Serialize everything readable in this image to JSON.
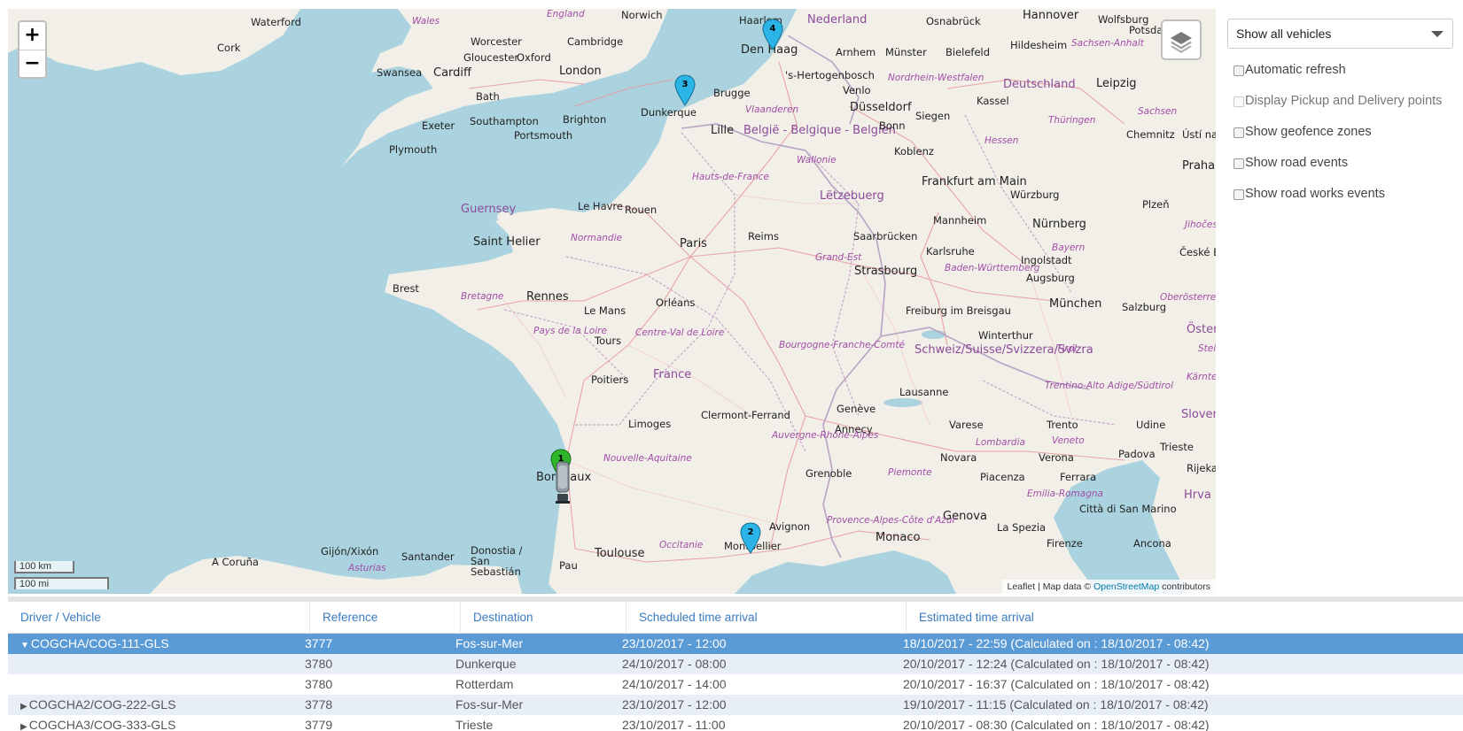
{
  "map": {
    "zoom_in": "+",
    "zoom_out": "−",
    "scale_km": "100 km",
    "scale_mi": "100 mi",
    "attribution_prefix": "Leaflet | Map data ©",
    "attribution_link": "OpenStreetMap",
    "attribution_suffix": "contributors",
    "markers": [
      {
        "number": "1",
        "color": "#2fb52b"
      },
      {
        "number": "2",
        "color": "#2ab4e8"
      },
      {
        "number": "3",
        "color": "#2ab4e8"
      },
      {
        "number": "4",
        "color": "#2ab4e8"
      }
    ],
    "labels": {
      "waterford": "Waterford",
      "cork": "Cork",
      "wales": "Wales",
      "england": "England",
      "norwich": "Norwich",
      "worcester": "Worcester",
      "cambridge": "Cambridge",
      "gloucester": "Gloucester",
      "oxford": "Oxford",
      "swansea": "Swansea",
      "cardiff": "Cardiff",
      "london": "London",
      "bath": "Bath",
      "exeter": "Exeter",
      "southampton": "Southampton",
      "brighton": "Brighton",
      "portsmouth": "Portsmouth",
      "plymouth": "Plymouth",
      "haarlem": "Haarlem",
      "nederland": "Nederland",
      "den_haag": "Den Haag",
      "arnhem": "Arnhem",
      "munster": "Münster",
      "osnabruck": "Osnabrück",
      "bielefeld": "Bielefeld",
      "hannover": "Hannover",
      "wolfsburg": "Wolfsburg",
      "potsdam": "Potsdam",
      "hildesheim": "Hildesheim",
      "sachsen_anhalt": "Sachsen-Anhalt",
      "hertogenbosch": "'s-Hertogenbosch",
      "venlo": "Venlo",
      "nordrhein": "Nordrhein-Westfalen",
      "deutschland": "Deutschland",
      "leipzig": "Leipzig",
      "brugge": "Brugge",
      "dunkerque": "Dunkerque",
      "vlaanderen": "Vlaanderen",
      "dusseldorf": "Düsseldorf",
      "kassel": "Kassel",
      "siegen": "Siegen",
      "sachsen": "Sachsen",
      "lille": "Lille",
      "belgie": "België - Belgique - Belgien",
      "bonn": "Bonn",
      "thuringen": "Thüringen",
      "chemnitz": "Chemnitz",
      "usti": "Ústí nad Labem",
      "wallonie": "Wallonie",
      "koblenz": "Koblenz",
      "hessen": "Hessen",
      "praha": "Praha",
      "hauts_de_france": "Hauts-de-France",
      "frankfurt": "Frankfurt am Main",
      "letzebuerg": "Lëtzebuerg",
      "wurzburg": "Würzburg",
      "guernsey": "Guernsey",
      "le_havre": "Le Havre",
      "rouen": "Rouen",
      "mannheim": "Mannheim",
      "nurnberg": "Nürnberg",
      "plzen": "Plzeň",
      "jihocesky": "Jihočeský",
      "saint_helier": "Saint Helier",
      "normandie": "Normandie",
      "paris": "Paris",
      "reims": "Reims",
      "saarbrucken": "Saarbrücken",
      "karlsruhe": "Karlsruhe",
      "bayern": "Bayern",
      "ingolstadt": "Ingolstadt",
      "ceske": "České Budějovice",
      "grand_est": "Grand-Est",
      "strasbourg": "Strasbourg",
      "baden": "Baden-Württemberg",
      "augsburg": "Augsburg",
      "brest": "Brest",
      "bretagne": "Bretagne",
      "rennes": "Rennes",
      "orleans": "Orléans",
      "oberosterreich": "Oberösterreich",
      "le_mans": "Le Mans",
      "freiburg": "Freiburg im Breisgau",
      "munchen": "München",
      "salzburg": "Salzburg",
      "pays_de_la_loire": "Pays de la Loire",
      "tours": "Tours",
      "centre": "Centre-Val de Loire",
      "bourgogne": "Bourgogne-Franche-Comté",
      "winterthur": "Winterthur",
      "oster": "Öster",
      "schweiz": "Schweiz/Suisse/Svizzera/Svizra",
      "tirol": "Tirol",
      "steier": "Steier",
      "poitiers": "Poitiers",
      "france": "France",
      "lausanne": "Lausanne",
      "karnten": "Kärnten",
      "trentino": "Trentino-Alto Adige/Südtirol",
      "geneve": "Genève",
      "limoges": "Limoges",
      "clermont": "Clermont-Ferrand",
      "annecy": "Annecy",
      "varese": "Varese",
      "trento": "Trento",
      "udine": "Udine",
      "sloven": "Sloven",
      "auvergne": "Auvergne-Rhône-Alpes",
      "lombardia": "Lombardia",
      "veneto": "Veneto",
      "trieste": "Trieste",
      "nouvelle_aquitaine": "Nouvelle-Aquitaine",
      "padova": "Padova",
      "rijeka": "Rijeka",
      "novara": "Novara",
      "verona": "Verona",
      "bordeaux": "Bordeaux",
      "grenoble": "Grenoble",
      "piemonte": "Piemonte",
      "piacenza": "Piacenza",
      "ferrara": "Ferrara",
      "hrva": "Hrva",
      "emilia": "Emilia-Romagna",
      "citta": "Città di San Marino",
      "genova": "Genova",
      "provence": "Provence-Alpes-Côte d'Azur",
      "avignon": "Avignon",
      "la_spezia": "La Spezia",
      "monaco": "Monaco",
      "firenze": "Firenze",
      "ancona": "Ancona",
      "a_coruna": "A Coruña",
      "gijon": "Gijón/Xixón",
      "santander": "Santander",
      "donostia": "Donostia / San Sebastián",
      "asturias": "Asturias",
      "pau": "Pau",
      "toulouse": "Toulouse",
      "occitanie": "Occitanie",
      "montpellier": "Montpellier"
    }
  },
  "panel": {
    "select_value": "Show all vehicles",
    "options": [
      {
        "label": "Automatic refresh",
        "disabled": false
      },
      {
        "label": "Display Pickup and Delivery points",
        "disabled": true
      },
      {
        "label": "Show geofence zones",
        "disabled": false
      },
      {
        "label": "Show road events",
        "disabled": false
      },
      {
        "label": "Show road works events",
        "disabled": false
      }
    ]
  },
  "table": {
    "headers": [
      "Driver / Vehicle",
      "Reference",
      "Destination",
      "Scheduled time arrival",
      "Estimated time arrival"
    ],
    "rows": [
      {
        "toggle": "▼",
        "driver": "COGCHA/COG-111-GLS",
        "reference": "3777",
        "destination": "Fos-sur-Mer",
        "scheduled": "23/10/2017 - 12:00",
        "estimated": "18/10/2017 - 22:59 (Calculated on : 18/10/2017 - 08:42)"
      },
      {
        "toggle": "",
        "driver": "",
        "reference": "3780",
        "destination": "Dunkerque",
        "scheduled": "24/10/2017 - 08:00",
        "estimated": "20/10/2017 - 12:24 (Calculated on : 18/10/2017 - 08:42)"
      },
      {
        "toggle": "",
        "driver": "",
        "reference": "3780",
        "destination": "Rotterdam",
        "scheduled": "24/10/2017 - 14:00",
        "estimated": "20/10/2017 - 16:37 (Calculated on : 18/10/2017 - 08:42)"
      },
      {
        "toggle": "▶",
        "driver": "COGCHA2/COG-222-GLS",
        "reference": "3778",
        "destination": "Fos-sur-Mer",
        "scheduled": "23/10/2017 - 12:00",
        "estimated": "19/10/2017 - 11:15 (Calculated on : 18/10/2017 - 08:42)"
      },
      {
        "toggle": "▶",
        "driver": "COGCHA3/COG-333-GLS",
        "reference": "3779",
        "destination": "Trieste",
        "scheduled": "23/10/2017 - 11:00",
        "estimated": "20/10/2017 - 08:30 (Calculated on : 18/10/2017 - 08:42)"
      }
    ]
  }
}
